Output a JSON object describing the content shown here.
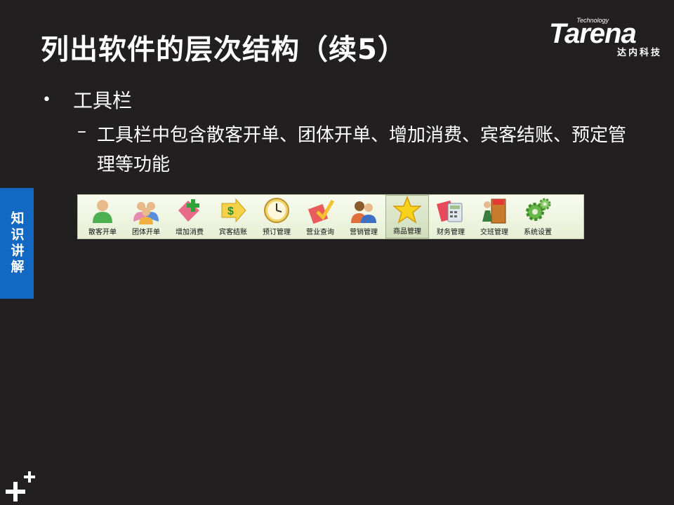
{
  "title": "列出软件的层次结构（续5）",
  "logo": {
    "tech": "Technology",
    "word": "Tarena",
    "cn": "达内科技"
  },
  "bullet": {
    "dot": "•",
    "text": "工具栏"
  },
  "sub": {
    "dash": "–",
    "text": "工具栏中包含散客开单、团体开单、增加消费、宾客结账、预定管理等功能"
  },
  "side_tab": "知识讲解",
  "toolbar": {
    "items": [
      {
        "label": "散客开单",
        "icon": "person-icon"
      },
      {
        "label": "团体开单",
        "icon": "group-icon"
      },
      {
        "label": "增加消费",
        "icon": "add-consumption-icon"
      },
      {
        "label": "宾客结账",
        "icon": "checkout-icon"
      },
      {
        "label": "预订管理",
        "icon": "clock-icon"
      },
      {
        "label": "营业查询",
        "icon": "query-icon"
      },
      {
        "label": "营销管理",
        "icon": "marketing-icon"
      },
      {
        "label": "商品管理",
        "icon": "star-icon",
        "active": true
      },
      {
        "label": "财务管理",
        "icon": "calculator-icon"
      },
      {
        "label": "交班管理",
        "icon": "exit-door-icon"
      },
      {
        "label": "系统设置",
        "icon": "gear-icon"
      }
    ]
  },
  "colors": {
    "background": "#221f20",
    "side_tab": "#1268c2",
    "toolbar_bg": "#eef4e0"
  }
}
